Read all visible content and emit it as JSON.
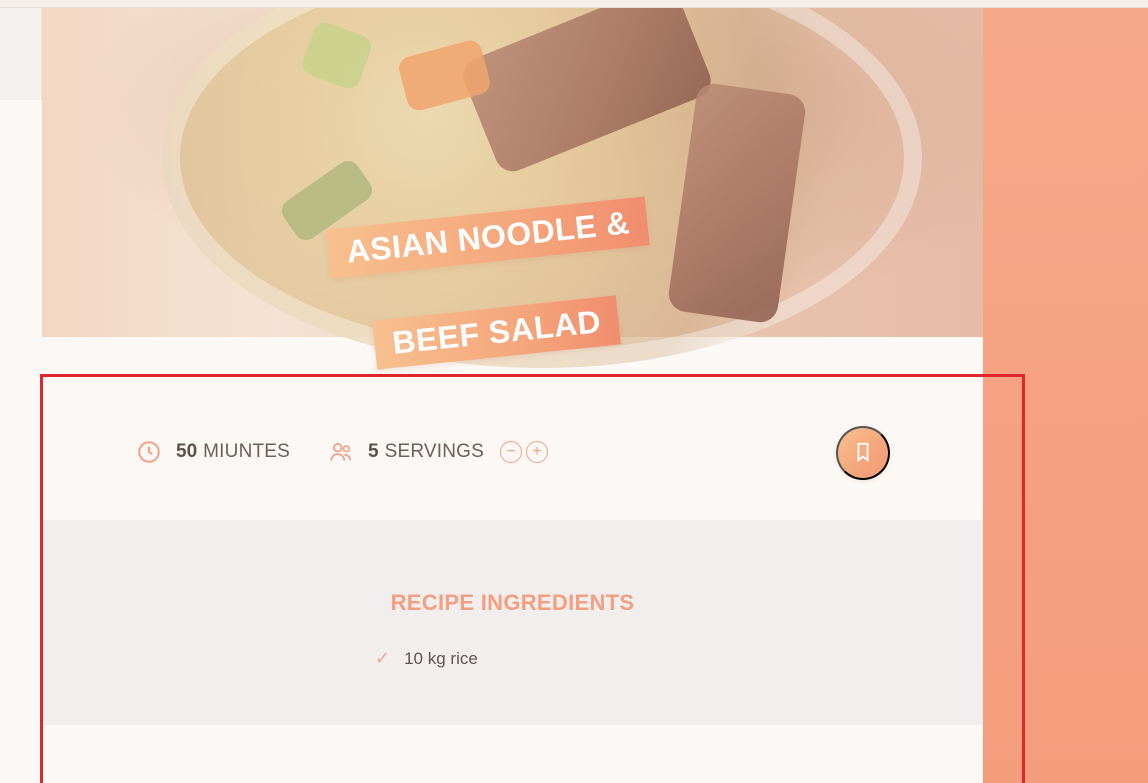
{
  "recipe": {
    "title_line1": "ASIAN NOODLE &",
    "title_line2": "BEEF SALAD",
    "image_alt": "Asian noodle and beef salad bowl"
  },
  "info": {
    "time_value": "50",
    "time_unit": "MIUNTES",
    "servings_value": "5",
    "servings_unit": "SERVINGS",
    "decrease_symbol": "−",
    "increase_symbol": "+"
  },
  "ingredients": {
    "heading": "RECIPE INGREDIENTS",
    "items": [
      {
        "text": "10 kg rice"
      }
    ]
  },
  "icons": {
    "time": "clock-icon",
    "servings": "users-icon",
    "bookmark": "bookmark-icon",
    "check": "check-icon"
  },
  "colors": {
    "accent": "#f2a081",
    "accent_gradient_start": "#f9c08f",
    "accent_gradient_end": "#f29a77",
    "highlight_border": "#e0262d"
  }
}
